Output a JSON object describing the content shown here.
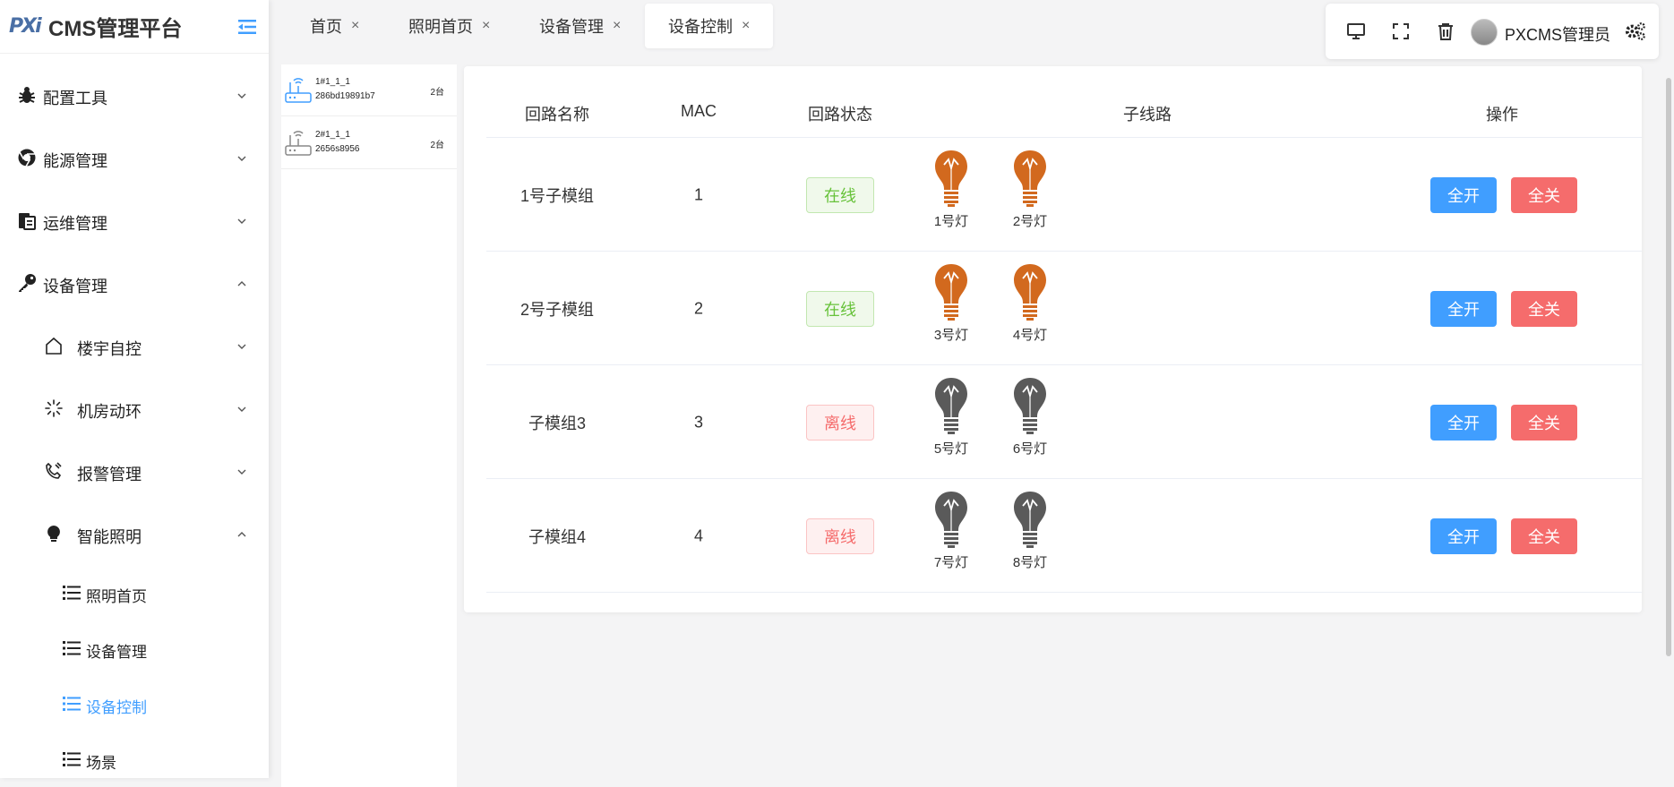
{
  "brand": {
    "logo_text": "PXi",
    "title": "CMS管理平台"
  },
  "sidebar": {
    "items": [
      {
        "label": "配置工具",
        "icon": "bug-icon",
        "expanded": false
      },
      {
        "label": "能源管理",
        "icon": "chrome-icon",
        "expanded": false
      },
      {
        "label": "运维管理",
        "icon": "clipboard-icon",
        "expanded": false
      },
      {
        "label": "设备管理",
        "icon": "key-icon",
        "expanded": true
      },
      {
        "label": "楼宇自控",
        "icon": "home-icon",
        "expanded": false
      },
      {
        "label": "机房动环",
        "icon": "loading-icon",
        "expanded": false
      },
      {
        "label": "报警管理",
        "icon": "phone-icon",
        "expanded": false
      },
      {
        "label": "智能照明",
        "icon": "bulb-icon",
        "expanded": true
      },
      {
        "label": "照明首页",
        "icon": "list-icon"
      },
      {
        "label": "设备管理",
        "icon": "list-icon"
      },
      {
        "label": "设备控制",
        "icon": "list-icon",
        "active": true
      },
      {
        "label": "场景",
        "icon": "list-icon"
      }
    ]
  },
  "tabs": [
    {
      "label": "首页",
      "close": "×"
    },
    {
      "label": "照明首页",
      "close": "×"
    },
    {
      "label": "设备管理",
      "close": "×"
    },
    {
      "label": "设备控制",
      "close": "×",
      "active": true
    }
  ],
  "toolbar": {
    "icons": [
      "monitor-icon",
      "fullscreen-icon",
      "trash-icon",
      "settings-icon"
    ],
    "username": "PXCMS管理员"
  },
  "devices": [
    {
      "name": "1#1_1_1",
      "mac": "286bd19891b7",
      "count": "2台",
      "color": "#409eff"
    },
    {
      "name": "2#1_1_1",
      "mac": "2656s8956",
      "count": "2台",
      "color": "#888888"
    }
  ],
  "table": {
    "headers": {
      "name": "回路名称",
      "mac": "MAC",
      "status": "回路状态",
      "sub": "子线路",
      "ops": "操作"
    },
    "rows": [
      {
        "name": "1号子模组",
        "mac": "1",
        "status": "在线",
        "online": true,
        "lights": [
          {
            "label": "1号灯",
            "on": true
          },
          {
            "label": "2号灯",
            "on": true
          }
        ],
        "btn_on": "全开",
        "btn_off": "全关"
      },
      {
        "name": "2号子模组",
        "mac": "2",
        "status": "在线",
        "online": true,
        "lights": [
          {
            "label": "3号灯",
            "on": true
          },
          {
            "label": "4号灯",
            "on": true
          }
        ],
        "btn_on": "全开",
        "btn_off": "全关"
      },
      {
        "name": "子模组3",
        "mac": "3",
        "status": "离线",
        "online": false,
        "lights": [
          {
            "label": "5号灯",
            "on": false
          },
          {
            "label": "6号灯",
            "on": false
          }
        ],
        "btn_on": "全开",
        "btn_off": "全关"
      },
      {
        "name": "子模组4",
        "mac": "4",
        "status": "离线",
        "online": false,
        "lights": [
          {
            "label": "7号灯",
            "on": false
          },
          {
            "label": "8号灯",
            "on": false
          }
        ],
        "btn_on": "全开",
        "btn_off": "全关"
      }
    ]
  },
  "colors": {
    "accent": "#409eff",
    "danger": "#f56c6c",
    "bulb_on": "#d2691e",
    "bulb_off": "#5a5a5a"
  }
}
